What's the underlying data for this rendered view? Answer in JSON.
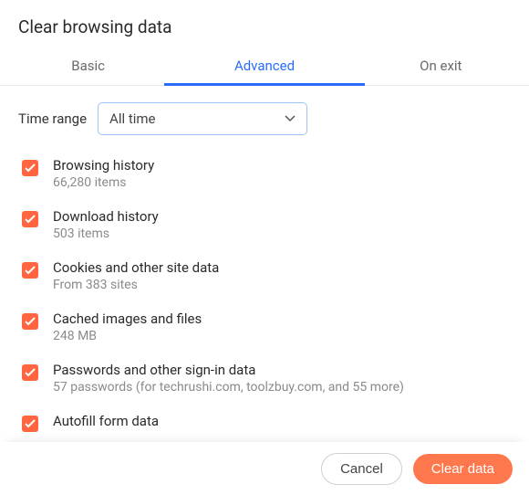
{
  "title": "Clear browsing data",
  "tabs": {
    "basic": "Basic",
    "advanced": "Advanced",
    "onexit": "On exit"
  },
  "timeRange": {
    "label": "Time range",
    "value": "All time"
  },
  "items": [
    {
      "title": "Browsing history",
      "sub": "66,280 items",
      "checked": true
    },
    {
      "title": "Download history",
      "sub": "503 items",
      "checked": true
    },
    {
      "title": "Cookies and other site data",
      "sub": "From 383 sites",
      "checked": true
    },
    {
      "title": "Cached images and files",
      "sub": "248 MB",
      "checked": true
    },
    {
      "title": "Passwords and other sign-in data",
      "sub": "57 passwords (for techrushi.com, toolzbuy.com, and 55 more)",
      "checked": true
    },
    {
      "title": "Autofill form data",
      "sub": "",
      "checked": true
    }
  ],
  "buttons": {
    "cancel": "Cancel",
    "clear": "Clear data"
  }
}
